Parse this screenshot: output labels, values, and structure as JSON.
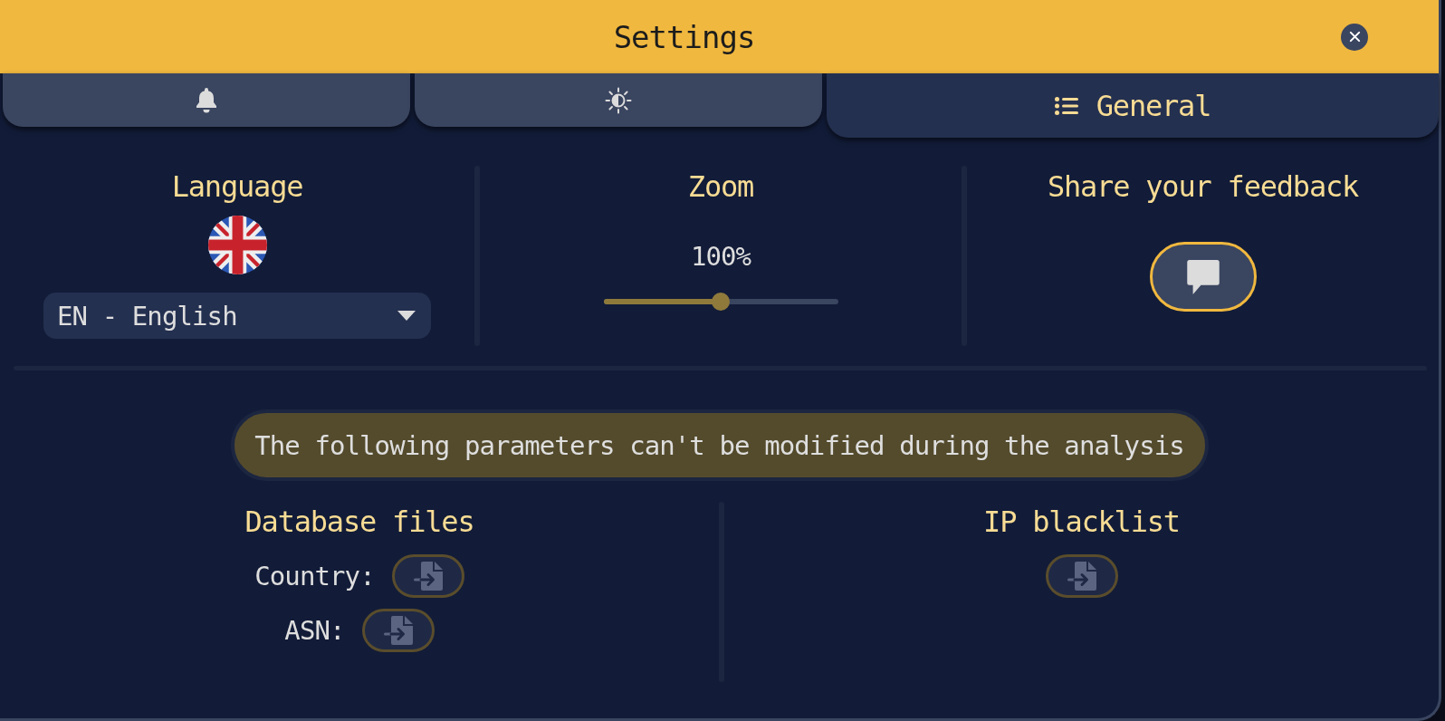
{
  "window": {
    "title": "Settings"
  },
  "tabs": [
    {
      "selected": false
    },
    {
      "selected": false
    },
    {
      "label": "General",
      "selected": true
    }
  ],
  "language": {
    "title": "Language",
    "select": {
      "value": "EN - English"
    }
  },
  "zoom": {
    "title": "Zoom",
    "reading": "100%",
    "level": 0.5
  },
  "feedback": {
    "title": "Share your feedback"
  },
  "notice": "The following parameters can't be modified during the analysis",
  "database_files": {
    "title": "Database files",
    "items": [
      {
        "label": "Country:",
        "disabled": true
      },
      {
        "label": "ASN:",
        "disabled": true
      }
    ]
  },
  "ip_blacklist": {
    "title": "IP blacklist",
    "disabled": true
  }
}
